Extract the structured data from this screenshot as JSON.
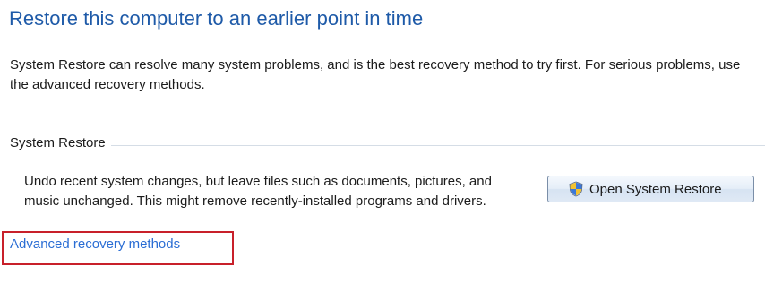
{
  "header": {
    "title": "Restore this computer to an earlier point in time"
  },
  "intro": {
    "text": "System Restore can resolve many system problems, and is the best recovery method to try first. For serious problems, use the advanced recovery methods."
  },
  "system_restore": {
    "group_label": "System Restore",
    "description": "Undo recent system changes, but leave files such as documents, pictures, and music unchanged. This might remove recently-installed programs and drivers.",
    "button_label": "Open System Restore",
    "button_icon": "uac-shield-icon"
  },
  "advanced_link": {
    "label": "Advanced recovery methods",
    "highlight_color": "#c8202a"
  },
  "colors": {
    "title": "#1e5aa8",
    "link": "#2a6dd4",
    "text": "#1b1b1b"
  }
}
